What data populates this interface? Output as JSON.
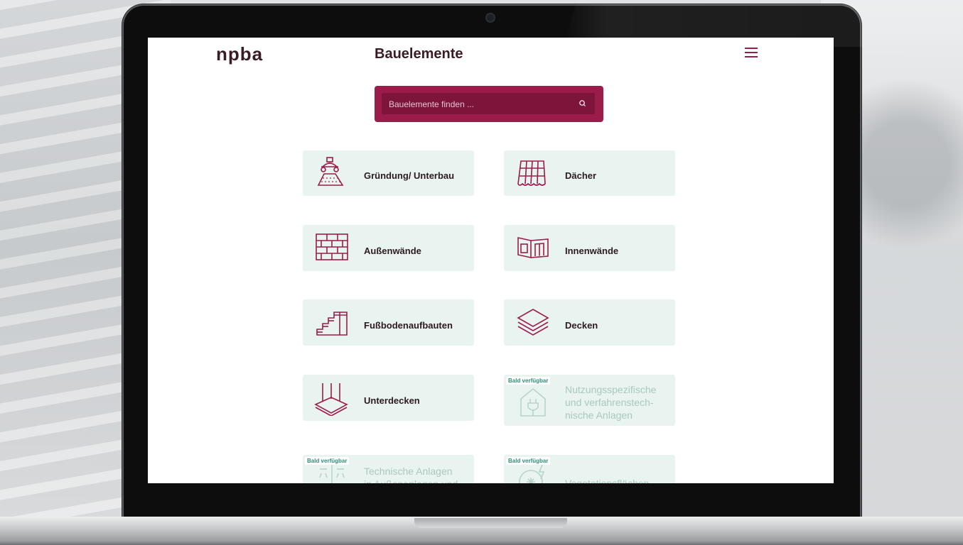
{
  "header": {
    "logo": "npba",
    "title": "Bauelemente",
    "menu_icon": "hamburger-icon"
  },
  "search": {
    "placeholder": "Bauelemente finden ...",
    "icon": "search-icon"
  },
  "colors": {
    "brand": "#9b1c4a",
    "brand_dark": "#7d1439",
    "card_bg": "#e9f4f1",
    "badge_text": "#2f8f78",
    "disabled_text": "#a9c8bf"
  },
  "cards": [
    {
      "label": "Gründung/ Unterbau",
      "icon": "foundation-icon",
      "available": true
    },
    {
      "label": "Dächer",
      "icon": "roof-tiles-icon",
      "available": true
    },
    {
      "label": "Außenwände",
      "icon": "brick-wall-icon",
      "available": true
    },
    {
      "label": "Innenwände",
      "icon": "interior-walls-icon",
      "available": true
    },
    {
      "label": "Fußbodenaufbauten",
      "icon": "floor-layers-icon",
      "available": true
    },
    {
      "label": "Decken",
      "icon": "ceiling-layers-icon",
      "available": true
    },
    {
      "label": "Unterdecken",
      "icon": "suspended-ceiling-icon",
      "available": true
    },
    {
      "label": "Nutzungsspezifische und verfahrenstech-nische Anlagen",
      "label_lines": [
        "Nutzungsspezifische",
        "und verfahrenstech-",
        "nische Anlagen"
      ],
      "icon": "house-plug-icon",
      "available": false,
      "badge": "Bald verfügbar"
    },
    {
      "label_lines": [
        "Technische Anlagen",
        "in Außenanlagen und"
      ],
      "icon": "outdoor-lights-icon",
      "available": false,
      "badge": "Bald verfügbar"
    },
    {
      "label": "Vegetationsflächen",
      "icon": "vegetation-icon",
      "available": false,
      "badge": "Bald verfügbar"
    }
  ]
}
